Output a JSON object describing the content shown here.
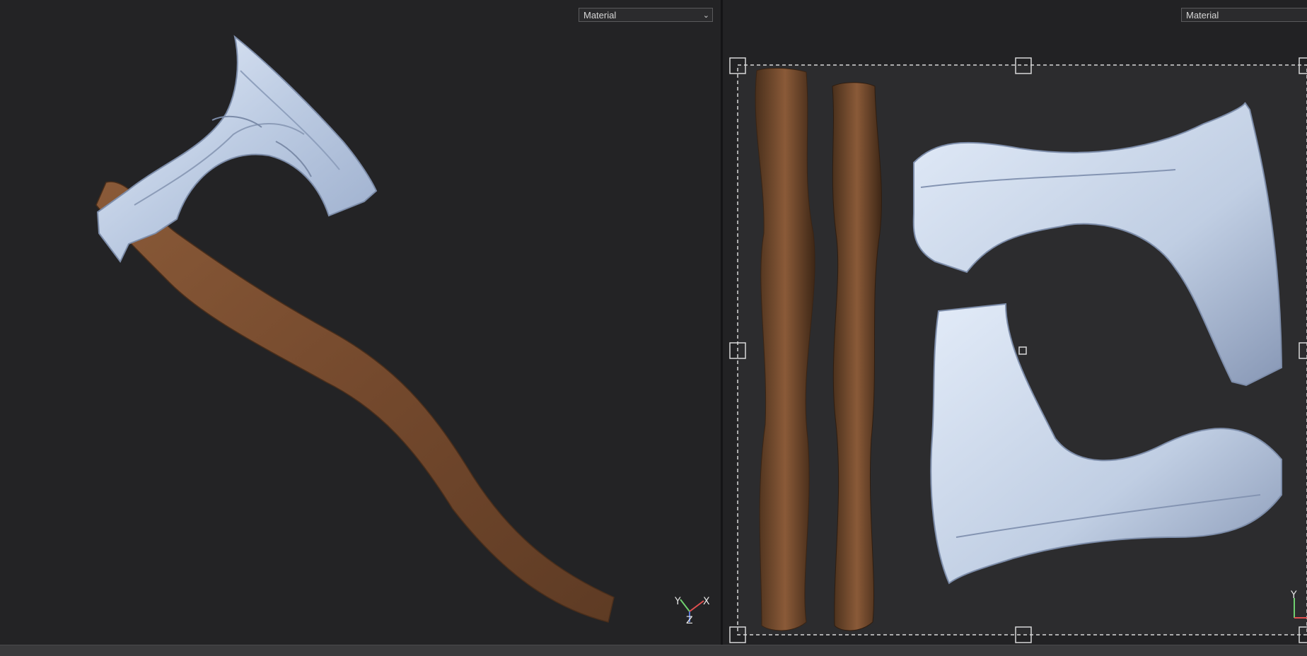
{
  "viewport3d": {
    "shading_select": {
      "value": "Material"
    },
    "gizmo": {
      "y_label": "Y",
      "x_label": "X",
      "z_label": "Z"
    }
  },
  "viewport2d": {
    "shading_select": {
      "value": "Material"
    },
    "gizmo": {
      "y_label": "Y"
    }
  },
  "colors": {
    "background": "#232325",
    "metal": "#b7c6dd",
    "wood": "#7a5032",
    "selection": "#d8d8d8"
  }
}
